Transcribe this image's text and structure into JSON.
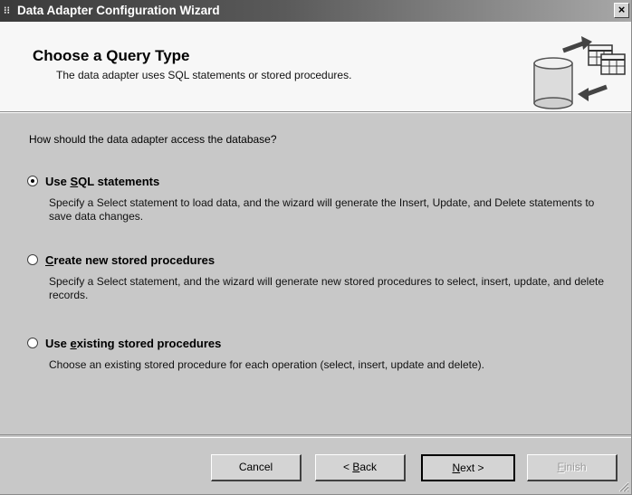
{
  "window": {
    "title": "Data Adapter Configuration Wizard",
    "title_icon": "wizard-icon",
    "close_label": "×"
  },
  "header": {
    "title": "Choose a Query Type",
    "subtitle": "The data adapter uses SQL statements or stored procedures."
  },
  "body": {
    "question": "How should the data adapter access the database?",
    "options": [
      {
        "label_before": "Use ",
        "mnemonic": "S",
        "label_after": "QL statements",
        "checked": true,
        "description": "Specify a Select statement to load data, and the wizard will generate the Insert, Update, and Delete statements to save data changes."
      },
      {
        "label_before": "",
        "mnemonic": "C",
        "label_after": "reate new stored procedures",
        "checked": false,
        "description": "Specify a Select statement, and the wizard will generate new stored procedures to select, insert, update, and delete records."
      },
      {
        "label_before": "Use ",
        "mnemonic": "e",
        "label_after": "xisting stored procedures",
        "checked": false,
        "description": "Choose an existing stored procedure for each operation (select, insert, update and delete)."
      }
    ]
  },
  "buttons": {
    "cancel": "Cancel",
    "back_prefix": "< ",
    "back_mnemonic": "B",
    "back_rest": "ack",
    "next_mnemonic": "N",
    "next_rest": "ext >",
    "finish_mnemonic": "F",
    "finish_rest": "inish"
  },
  "colors": {
    "dialog_bg": "#c8c8c8",
    "header_bg": "#f7f7f7",
    "titlebar_dark": "#3a3a3a"
  }
}
